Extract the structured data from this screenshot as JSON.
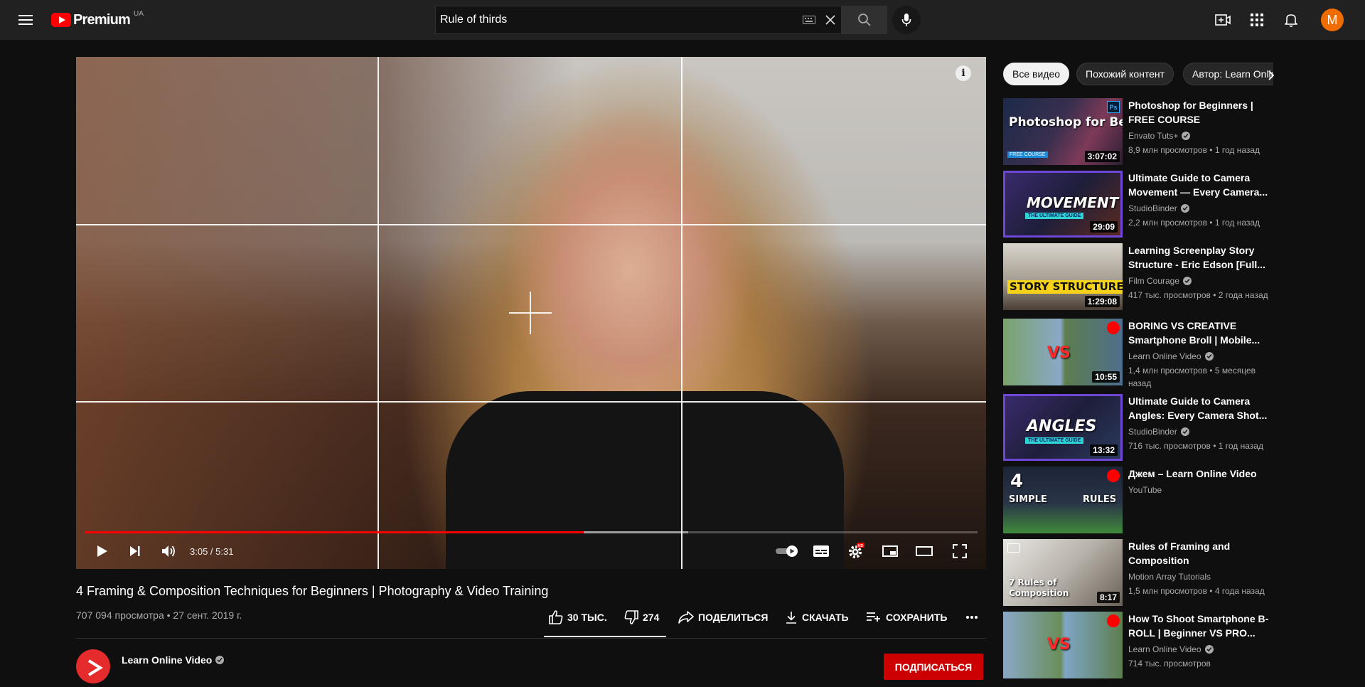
{
  "header": {
    "logo_text": "Premium",
    "region": "UA",
    "search_value": "Rule of thirds",
    "avatar_letter": "M"
  },
  "player": {
    "time_current": "3:05",
    "time_total": "5:31",
    "time_display": "3:05 / 5:31",
    "progress_played": 0.559,
    "progress_loaded": 0.676,
    "info_label": "i",
    "hd_badge": "HD"
  },
  "video": {
    "title": "4 Framing & Composition Techniques for Beginners | Photography & Video Training",
    "views": "707 094 просмотра",
    "date": "27 сент. 2019 г.",
    "meta": "707 094 просмотра • 27 сент. 2019 г.",
    "likes": "30 ТЫС.",
    "dislikes": "274",
    "share_label": "ПОДЕЛИТЬСЯ",
    "download_label": "СКАЧАТЬ",
    "save_label": "СОХРАНИТЬ"
  },
  "channel": {
    "name": "Learn Online Video",
    "subscribe_label": "ПОДПИСАТЬСЯ"
  },
  "chips": [
    {
      "label": "Все видео",
      "active": true
    },
    {
      "label": "Похожий контент",
      "active": false
    },
    {
      "label": "Автор: Learn Online Video",
      "active": false
    }
  ],
  "recommendations": [
    {
      "title": "Photoshop for Beginners | FREE COURSE",
      "channel": "Envato Tuts+",
      "stats": "8,9 млн просмотров • 1 год назад",
      "duration": "3:07:02",
      "thumb_text": "Photoshop for Beginners",
      "thumb_sub": "FREE COURSE"
    },
    {
      "title": "Ultimate Guide to Camera Movement — Every Camera...",
      "channel": "StudioBinder",
      "stats": "2,2 млн просмотров • 1 год назад",
      "duration": "29:09",
      "thumb_text": "MOVEMENT",
      "thumb_sub": "THE ULTIMATE GUIDE"
    },
    {
      "title": "Learning Screenplay Story Structure - Eric Edson [Full...",
      "channel": "Film Courage",
      "stats": "417 тыс. просмотров • 2 года назад",
      "duration": "1:29:08",
      "thumb_text": "STORY STRUCTURE",
      "thumb_sub": ""
    },
    {
      "title": "BORING VS CREATIVE Smartphone Broll | Mobile...",
      "channel": "Learn Online Video",
      "stats": "1,4 млн просмотров • 5 месяцев назад",
      "duration": "10:55",
      "thumb_text": "VS",
      "thumb_sub": ""
    },
    {
      "title": "Ultimate Guide to Camera Angles: Every Camera Shot...",
      "channel": "StudioBinder",
      "stats": "716 тыс. просмотров • 1 год назад",
      "duration": "13:32",
      "thumb_text": "ANGLES",
      "thumb_sub": "THE ULTIMATE GUIDE"
    },
    {
      "title": "Джем – Learn Online Video",
      "channel": "YouTube",
      "stats": "",
      "duration": "",
      "thumb_text": "SIMPLE",
      "thumb_sub": "RULES"
    },
    {
      "title": "Rules of Framing and Composition",
      "channel": "Motion Array Tutorials",
      "stats": "1,5 млн просмотров • 4 года назад",
      "duration": "8:17",
      "thumb_text": "7 Rules of Composition",
      "thumb_sub": ""
    },
    {
      "title": "How To Shoot Smartphone B-ROLL | Beginner VS PRO...",
      "channel": "Learn Online Video",
      "stats": "714 тыс. просмотров",
      "duration": "",
      "thumb_text": "VS",
      "thumb_sub": ""
    }
  ],
  "colors": {
    "brand_red": "#ff0000",
    "avatar": "#ef6c00",
    "subscribe": "#cc0000",
    "background": "#0f0f0f"
  },
  "icons": [
    "menu-icon",
    "youtube-logo-icon",
    "keyboard-icon",
    "clear-icon",
    "search-icon",
    "mic-icon",
    "create-icon",
    "apps-icon",
    "notifications-icon",
    "play-icon",
    "next-icon",
    "volume-icon",
    "autoplay-toggle",
    "subtitles-icon",
    "settings-icon",
    "miniplayer-icon",
    "theater-icon",
    "fullscreen-icon",
    "like-icon",
    "dislike-icon",
    "share-icon",
    "download-icon",
    "save-icon",
    "more-icon",
    "verified-icon",
    "chevron-right-icon"
  ]
}
